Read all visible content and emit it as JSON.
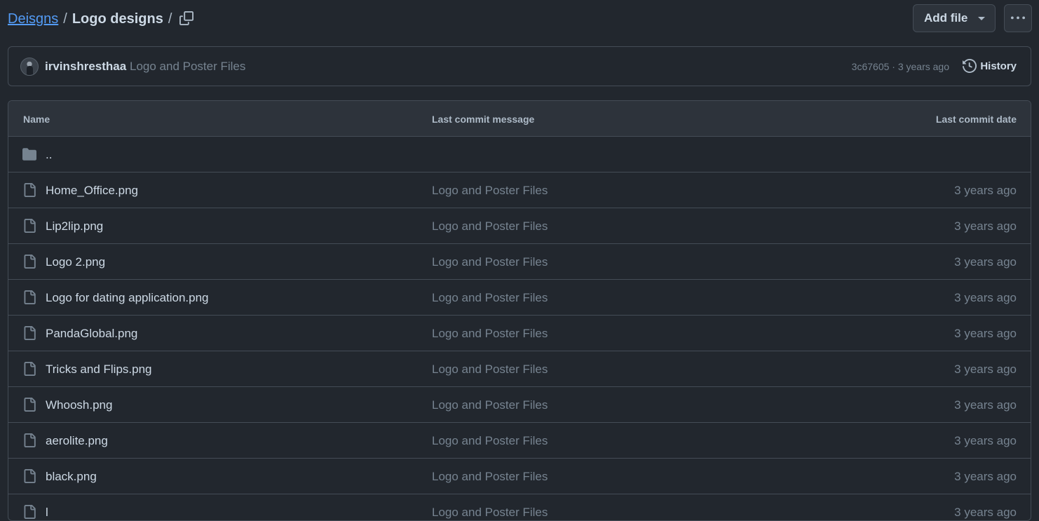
{
  "breadcrumb": {
    "parent": "Deisgns",
    "separator": "/",
    "current": "Logo designs",
    "trailing_separator": "/"
  },
  "toolbar": {
    "add_file_label": "Add file"
  },
  "commit": {
    "author": "irvinshresthaa",
    "message": "Logo and Poster Files",
    "meta": "3c67605 · 3 years ago",
    "history_label": "History"
  },
  "table": {
    "columns": {
      "name": "Name",
      "message": "Last commit message",
      "date": "Last commit date"
    },
    "parent_dir": "..",
    "files": [
      {
        "name": "Home_Office.png",
        "message": "Logo and Poster Files",
        "date": "3 years ago"
      },
      {
        "name": "Lip2lip.png",
        "message": "Logo and Poster Files",
        "date": "3 years ago"
      },
      {
        "name": "Logo 2.png",
        "message": "Logo and Poster Files",
        "date": "3 years ago"
      },
      {
        "name": "Logo for dating application.png",
        "message": "Logo and Poster Files",
        "date": "3 years ago"
      },
      {
        "name": "PandaGlobal.png",
        "message": "Logo and Poster Files",
        "date": "3 years ago"
      },
      {
        "name": "Tricks and Flips.png",
        "message": "Logo and Poster Files",
        "date": "3 years ago"
      },
      {
        "name": "Whoosh.png",
        "message": "Logo and Poster Files",
        "date": "3 years ago"
      },
      {
        "name": "aerolite.png",
        "message": "Logo and Poster Files",
        "date": "3 years ago"
      },
      {
        "name": "black.png",
        "message": "Logo and Poster Files",
        "date": "3 years ago"
      },
      {
        "name": "l",
        "message": "Logo and Poster Files",
        "date": "3 years ago"
      }
    ]
  },
  "colors": {
    "background": "#22272e",
    "header_bg": "#2d333b",
    "border": "#444c56",
    "link": "#539bf5",
    "text_primary": "#cdd9e5",
    "text_muted": "#768390"
  },
  "icons": {
    "copy": "copy-icon",
    "caret": "triangle-down-icon",
    "more": "kebab-horizontal-icon",
    "history": "history-icon",
    "folder": "folder-icon",
    "file": "file-icon"
  }
}
